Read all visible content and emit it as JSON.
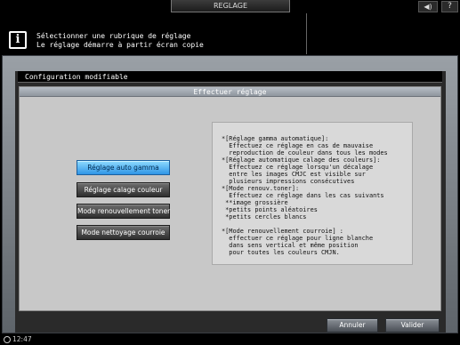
{
  "header": {
    "title": "REGLAGE",
    "speaker_icon": "◀)",
    "help_label": "?"
  },
  "message": {
    "line1": "Sélectionner une rubrique de réglage",
    "line2": "Le réglage démarre à partir écran copie"
  },
  "panel": {
    "subheader": "Configuration modifiable",
    "section_title": "Effectuer réglage"
  },
  "buttons": [
    {
      "label": "Réglage auto gamma",
      "selected": true
    },
    {
      "label": "Réglage calage couleur",
      "selected": false
    },
    {
      "label": "Mode renouvellement toner",
      "selected": false
    },
    {
      "label": "Mode nettoyage courroie",
      "selected": false
    }
  ],
  "description": [
    "*[Réglage gamma automatique]:",
    "  Effectuez ce réglage en cas de mauvaise",
    "  reproduction de couleur dans tous les modes",
    "*[Réglage automatique calage des couleurs]:",
    "  Effectuez ce réglage lorsqu'un décalage",
    "  entre les images CMJC est visible sur",
    "  plusieurs impressions consécutives",
    "*[Mode renouv.toner]:",
    "  Effectuez ce réglage dans les cas suivants",
    " **image grossière",
    " *petits points aléatoires",
    " *petits cercles blancs",
    "",
    "*[Mode renouvellement courroie] :",
    "  effectuer ce réglage pour ligne blanche",
    "  dans sens vertical et même position",
    "  pour toutes les couleurs CMJN."
  ],
  "footer": {
    "cancel_label": "Annuler",
    "ok_label": "Valider"
  },
  "status": {
    "time": "12:47"
  },
  "colors": {
    "selected_button": "#3fa6ef",
    "frame": "#7d838a"
  }
}
